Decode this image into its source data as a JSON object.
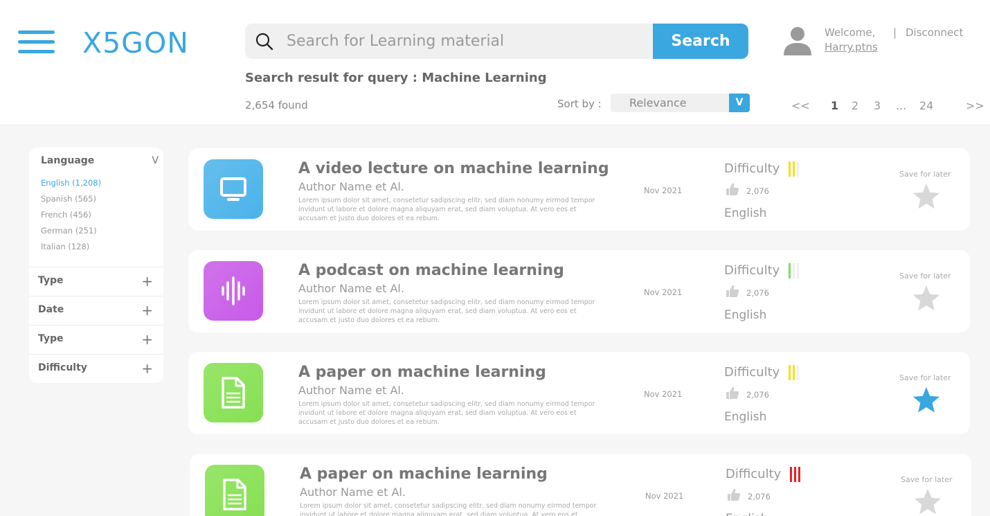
{
  "app": {
    "logo": "X5GON"
  },
  "search": {
    "placeholder": "Search for Learning material",
    "value": "",
    "button_label": "Search"
  },
  "user": {
    "welcome": "Welcome,",
    "separator": "|",
    "disconnect": "Disconnect",
    "username": "Harry.ptns"
  },
  "results": {
    "query_title": "Search result for query : Machine Learning",
    "found": "2,654 found"
  },
  "sort": {
    "label": "Sort by :",
    "value": "Relevance",
    "arrow": "V"
  },
  "pagination": {
    "prev": "<<",
    "pages": [
      "1",
      "2",
      "3"
    ],
    "dots": "...",
    "last": "24",
    "next": ">>",
    "current": "1"
  },
  "sidebar": {
    "language": {
      "label": "Language",
      "caret": "V",
      "items": [
        {
          "label": "English (1,208)",
          "active": true
        },
        {
          "label": "Spanish (565)"
        },
        {
          "label": "French (456)"
        },
        {
          "label": "German (251)"
        },
        {
          "label": "Italian (128)"
        }
      ]
    },
    "filters": [
      {
        "label": "Type",
        "icon": "+"
      },
      {
        "label": "Date",
        "icon": "+"
      },
      {
        "label": "Type",
        "icon": "+"
      },
      {
        "label": "Difficulty",
        "icon": "+"
      }
    ]
  },
  "cards": [
    {
      "icon": "monitor-icon",
      "color": "#4ab3ea",
      "title": "A video lecture on machine learning",
      "author": "Author Name et Al.",
      "desc": "Lorem ipsum dolor sit amet, consetetur sadipscing elitr, sed diam nonumy eirmod tempor invidunt ut labore et dolore magna aliquyam erat, sed diam voluptua. At vero eos et accusam et justo duo dolores et ea rebum.",
      "date": "Nov 2021",
      "difficulty_label": "Difficulty",
      "difficulty_level": 2,
      "difficulty_color": "#f5e11a",
      "likes": "2,076",
      "language": "English",
      "save_label": "Save for later",
      "saved": false
    },
    {
      "icon": "audio-wave-icon",
      "color": "#c85ae8",
      "title": "A podcast on machine learning",
      "author": "Author Name et Al.",
      "desc": "Lorem ipsum dolor sit amet, consetetur sadipscing elitr, sed diam nonumy eirmod tempor invidunt ut labore et dolore magna aliquyam erat, sed diam voluptua. At vero eos et accusam et justo duo dolores et ea rebum.",
      "date": "Nov 2021",
      "difficulty_label": "Difficulty",
      "difficulty_level": 1,
      "difficulty_color": "#7ee05a",
      "likes": "2,076",
      "language": "English",
      "save_label": "Save for later",
      "saved": false
    },
    {
      "icon": "document-icon",
      "color": "#86e052",
      "title": "A paper on machine learning",
      "author": "Author Name et Al.",
      "desc": "Lorem ipsum dolor sit amet, consetetur sadipscing elitr, sed diam nonumy eirmod tempor invidunt ut labore et dolore magna aliquyam erat, sed diam voluptua. At vero eos et accusam et justo duo dolores et ea rebum.",
      "date": "Nov 2021",
      "difficulty_label": "Difficulty",
      "difficulty_level": 2,
      "difficulty_color": "#f5e11a",
      "likes": "2,076",
      "language": "English",
      "save_label": "Save for later",
      "saved": true
    },
    {
      "icon": "document-icon",
      "color": "#86e052",
      "title": "A paper on machine learning",
      "author": "Author Name et Al.",
      "desc": "Lorem ipsum dolor sit amet, consetetur sadipscing elitr, sed diam nonumy eirmod tempor invidunt ut labore et dolore magna aliquyam erat, sed diam voluptua. At vero eos et accusam et justo duo dolores et ea rebum.",
      "date": "Nov 2021",
      "difficulty_label": "Difficulty",
      "difficulty_level": 3,
      "difficulty_color": "#f02020",
      "likes": "2,076",
      "language": "English",
      "save_label": "Save for later",
      "saved": false
    }
  ],
  "colors": {
    "accent": "#3aa7e0",
    "star_off": "#d8d8d8",
    "bar_off": "#efefef"
  }
}
